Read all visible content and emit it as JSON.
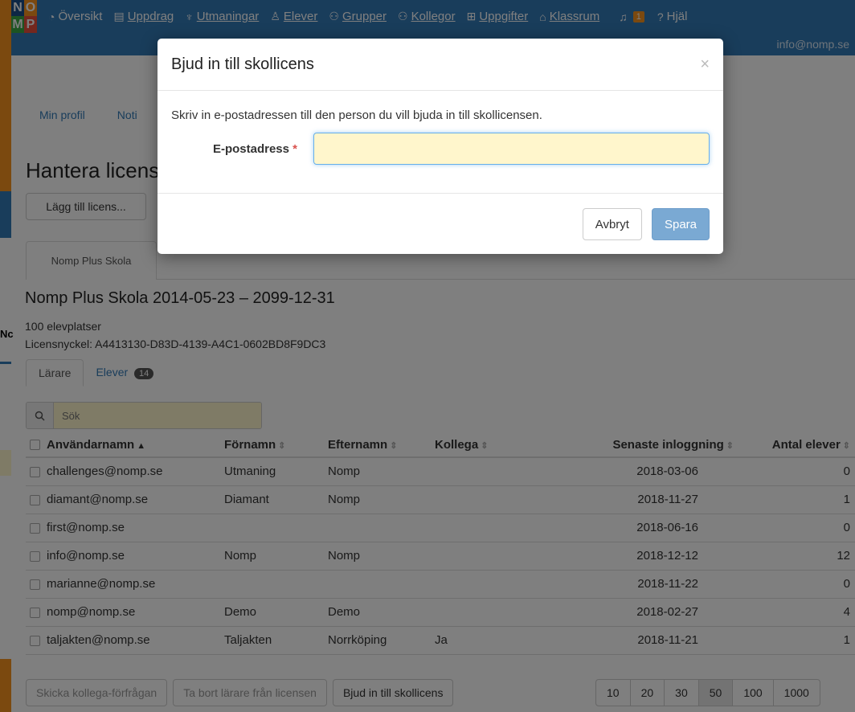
{
  "logo": {
    "letters": [
      "N",
      "O",
      "M",
      "P"
    ]
  },
  "nav": {
    "items": [
      {
        "icon": "dashboard-icon",
        "glyph": "◔",
        "label": "Översikt"
      },
      {
        "icon": "assignment-icon",
        "glyph": "▤",
        "label": "Uppdrag"
      },
      {
        "icon": "trophy-icon",
        "glyph": "♆",
        "label": "Utmaningar"
      },
      {
        "icon": "student-icon",
        "glyph": "♙",
        "label": "Elever"
      },
      {
        "icon": "groups-icon",
        "glyph": "⚇",
        "label": "Grupper"
      },
      {
        "icon": "colleagues-icon",
        "glyph": "⚇",
        "label": "Kollegor"
      },
      {
        "icon": "tasks-icon",
        "glyph": "⊞",
        "label": "Uppgifter"
      },
      {
        "icon": "classroom-icon",
        "glyph": "⌂",
        "label": "Klassrum"
      }
    ],
    "notification_count": "1",
    "help_label": "Hjäl",
    "user_email": "info@nomp.se"
  },
  "subnav": {
    "profile": "Min profil",
    "notifications": "Noti"
  },
  "page": {
    "title": "Hantera licens",
    "add_license_label": "Lägg till licens...",
    "license_tab": "Nomp Plus Skola",
    "license_heading": "Nomp Plus Skola 2014-05-23 – 2099-12-31",
    "seats": "100 elevplatser",
    "license_key": "Licensnyckel: A4413130-D83D-4139-A4C1-0602BD8F9DC3",
    "tab_teachers": "Lärare",
    "tab_students": "Elever",
    "students_count": "14",
    "search_placeholder": "Sök"
  },
  "table": {
    "headers": [
      "Användarnamn",
      "Förnamn",
      "Efternamn",
      "Kollega",
      "Senaste inloggning",
      "Antal elever"
    ],
    "rows": [
      [
        "challenges@nomp.se",
        "Utmaning",
        "Nomp",
        "",
        "2018-03-06",
        "0"
      ],
      [
        "diamant@nomp.se",
        "Diamant",
        "Nomp",
        "",
        "2018-11-27",
        "1"
      ],
      [
        "first@nomp.se",
        "",
        "",
        "",
        "2018-06-16",
        "0"
      ],
      [
        "info@nomp.se",
        "Nomp",
        "Nomp",
        "",
        "2018-12-12",
        "12"
      ],
      [
        "marianne@nomp.se",
        "",
        "",
        "",
        "2018-11-22",
        "0"
      ],
      [
        "nomp@nomp.se",
        "Demo",
        "Demo",
        "",
        "2018-02-27",
        "4"
      ],
      [
        "taljakten@nomp.se",
        "Taljakten",
        "Norrköping",
        "Ja",
        "2018-11-21",
        "1"
      ]
    ]
  },
  "actions": {
    "send_request": "Skicka kollega-förfrågan",
    "remove_teachers": "Ta bort lärare från licensen",
    "invite": "Bjud in till skollicens"
  },
  "pager": {
    "sizes": [
      "10",
      "20",
      "30",
      "50",
      "100",
      "1000"
    ],
    "active": "50"
  },
  "background_window": {
    "text": "Nc"
  },
  "modal": {
    "title": "Bjud in till skollicens",
    "close": "×",
    "description": "Skriv in e-postadressen till den person du vill bjuda in till skollicensen.",
    "email_label": "E-postadress",
    "required_mark": "*",
    "email_value": "",
    "cancel_label": "Avbryt",
    "save_label": "Spara"
  }
}
